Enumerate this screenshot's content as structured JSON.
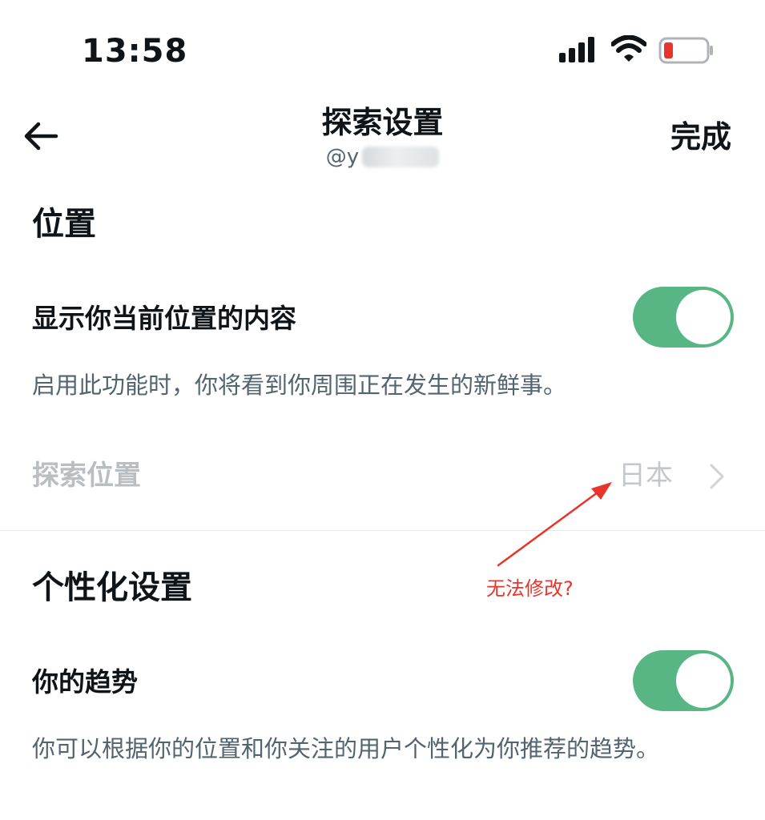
{
  "status_bar": {
    "time": "13:58",
    "icons": [
      "cellular-signal-icon",
      "wifi-icon",
      "battery-low-icon"
    ],
    "battery_color": "#e8352b"
  },
  "header": {
    "back_icon": "arrow-left-icon",
    "title": "探索设置",
    "handle": "@y",
    "done_label": "完成"
  },
  "location": {
    "section_title": "位置",
    "show_current": {
      "label": "显示你当前位置的内容",
      "on": true,
      "description": "启用此功能时，你将看到你周围正在发生的新鲜事。"
    },
    "explore_location": {
      "label": "探索位置",
      "value": "日本",
      "chevron_icon": "chevron-right-icon"
    }
  },
  "personalization": {
    "section_title": "个性化设置",
    "trends": {
      "label": "你的趋势",
      "on": true,
      "description": "你可以根据你的位置和你关注的用户个性化为你推荐的趋势。"
    }
  },
  "annotation": {
    "text": "无法修改?",
    "color": "#e8352b"
  },
  "colors": {
    "toggle_on": "#58b684",
    "text_primary": "#0f1419",
    "text_secondary": "#536471",
    "text_disabled": "#b9bec3"
  }
}
